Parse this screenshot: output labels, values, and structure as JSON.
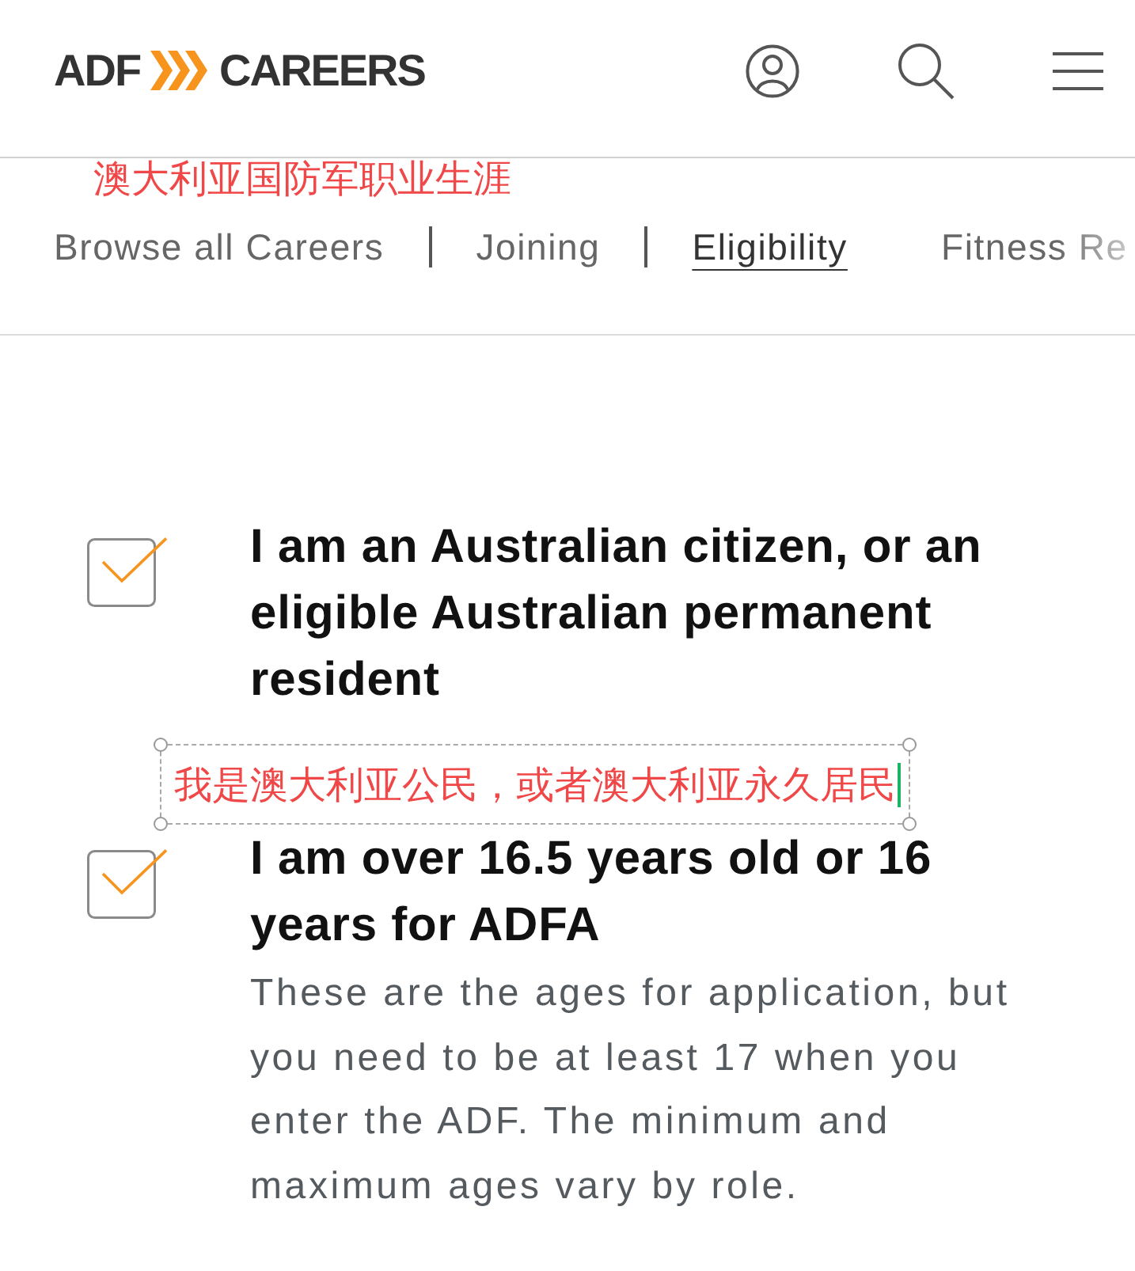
{
  "header": {
    "logo": {
      "left": "ADF",
      "right": "CAREERS"
    }
  },
  "nav": {
    "translation": {
      "text": "澳大利亚国防军职业生涯",
      "editing": false
    },
    "items": [
      {
        "label": "Browse all Careers",
        "selected": false,
        "divider_after": true
      },
      {
        "label": "Joining",
        "selected": false,
        "divider_after": true
      },
      {
        "label": "Eligibility",
        "selected": true,
        "divider_after": false
      },
      {
        "label": "Fitness Re",
        "selected": false,
        "divider_after": false
      }
    ]
  },
  "criteria": [
    {
      "checked": true,
      "title": "I am an Australian citizen, or an eligible Australian permanent resident",
      "translation": {
        "text": "我是澳大利亚公民，或者澳大利亚永久居民",
        "editing": true
      }
    },
    {
      "checked": true,
      "title": "I am over 16.5 years old or 16 years for ADFA",
      "description": "These are the ages for application, but you need to be at least 17 when you enter the ADF. The minimum and maximum ages vary by role."
    }
  ]
}
